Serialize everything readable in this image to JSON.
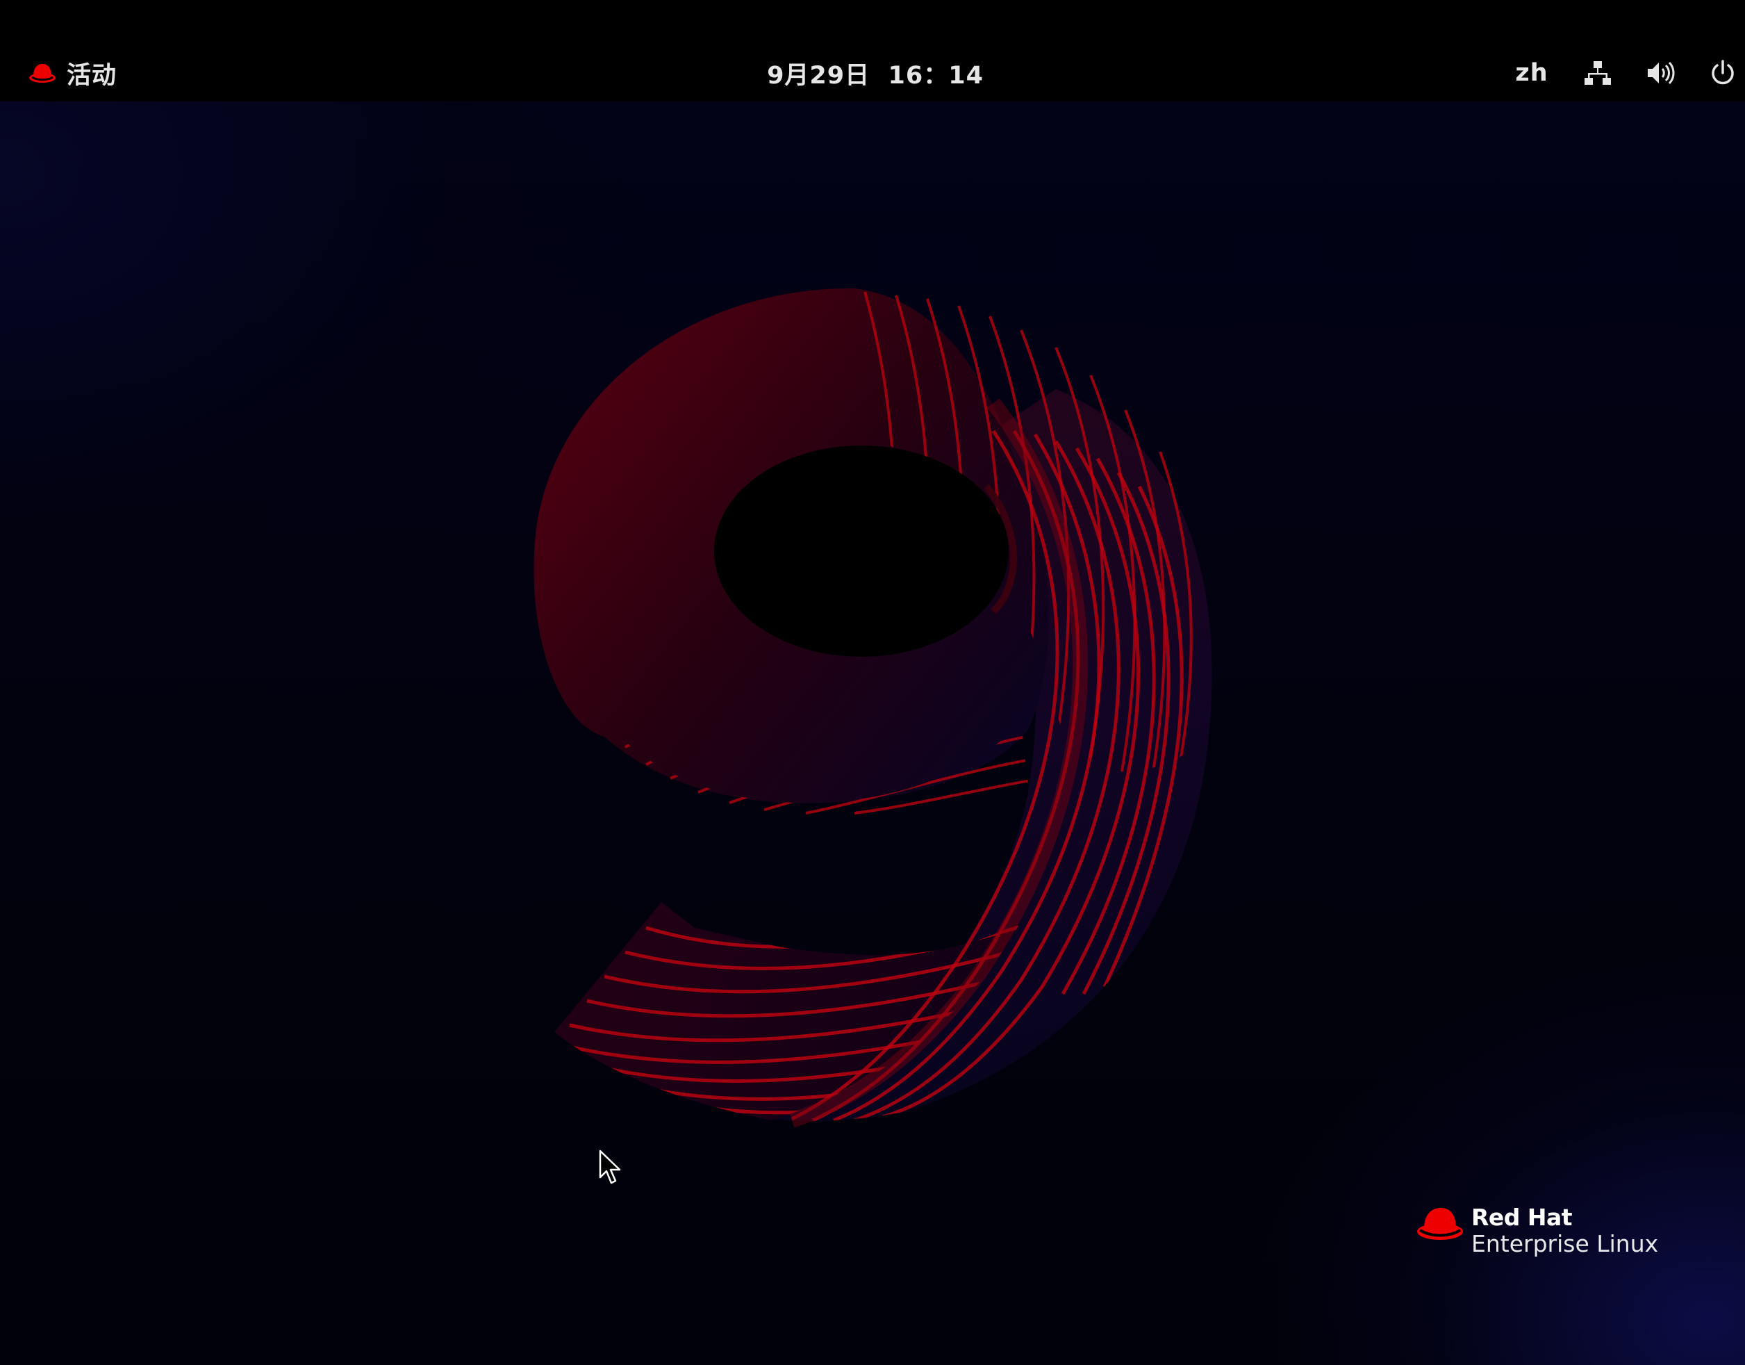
{
  "top_bar": {
    "activities_label": "活动",
    "clock_text": "9月29日  16：14",
    "input_source_label": "zh",
    "status_icons": [
      "network-wired-icon",
      "volume-high-icon",
      "power-icon"
    ]
  },
  "wallpaper": {
    "motif": "nine-numeral",
    "accent_color": "#ee0000",
    "background_color": "#020210"
  },
  "brand": {
    "line1": "Red Hat",
    "line2": "Enterprise Linux",
    "hat_color": "#ee0000"
  },
  "cursor": {
    "icon": "arrow-pointer-icon"
  }
}
